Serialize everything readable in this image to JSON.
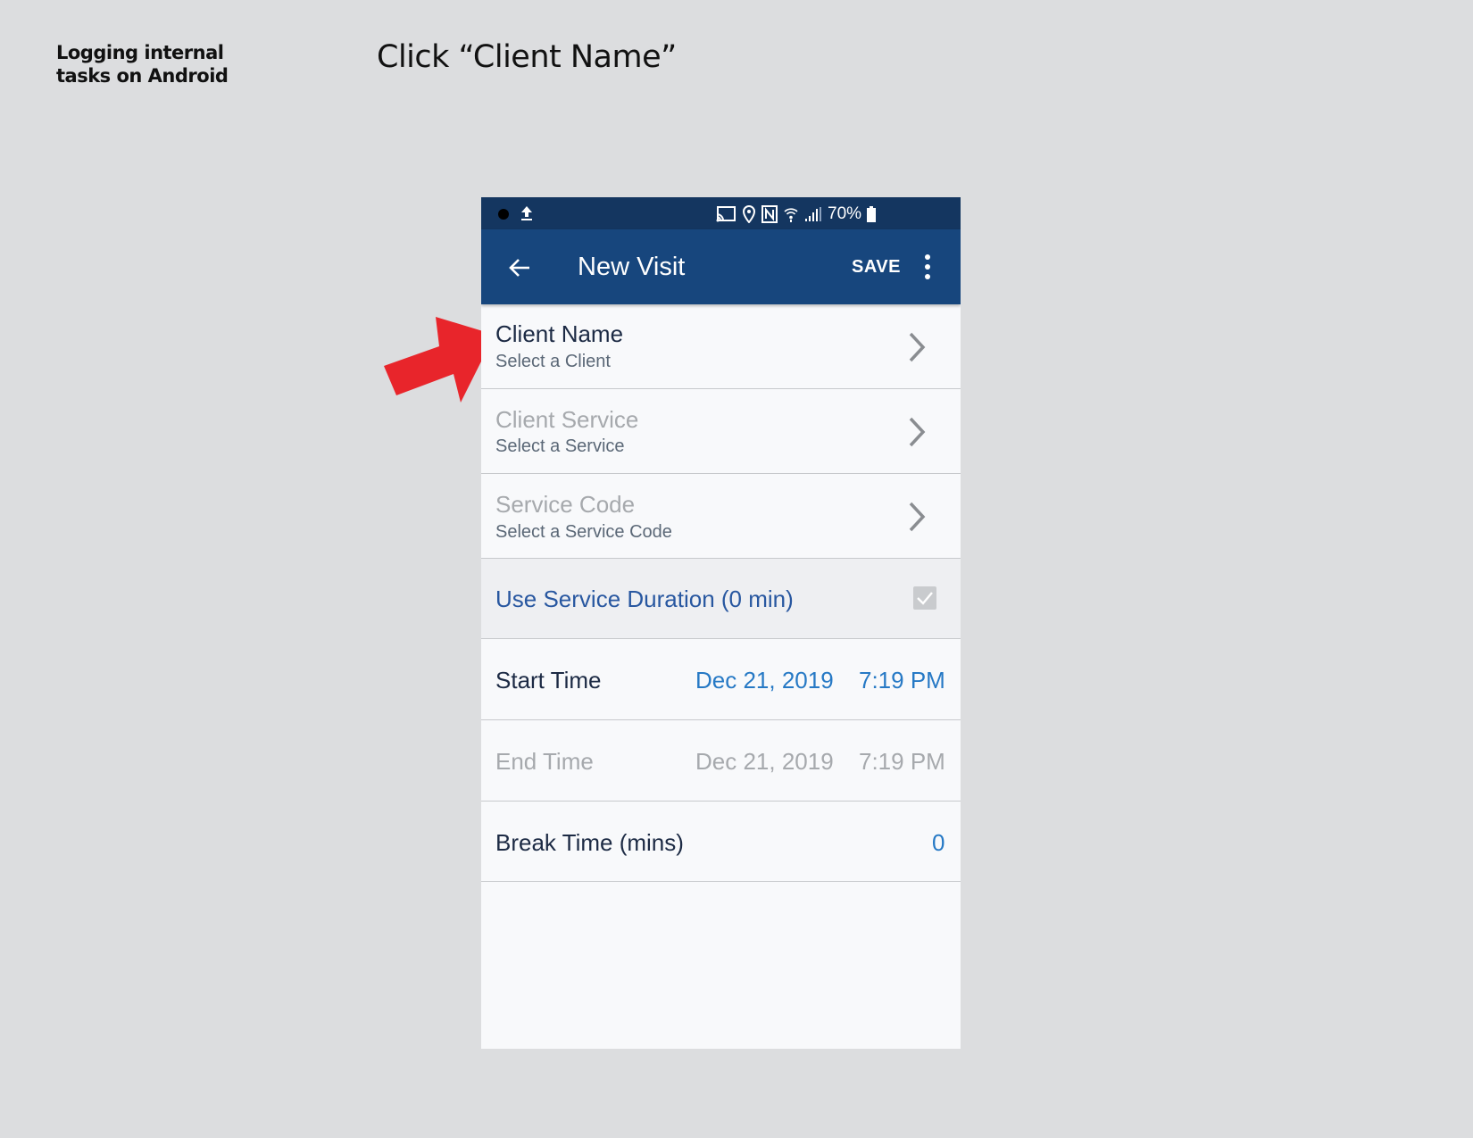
{
  "slide": {
    "title_line1": "Logging internal",
    "title_line2": "tasks on Android",
    "instruction": "Click “Client Name”"
  },
  "status_bar": {
    "battery": "70%"
  },
  "app_bar": {
    "title": "New Visit",
    "save_label": "SAVE"
  },
  "form": {
    "client_name": {
      "label": "Client Name",
      "sub": "Select a Client"
    },
    "client_service": {
      "label": "Client Service",
      "sub": "Select a Service"
    },
    "service_code": {
      "label": "Service Code",
      "sub": "Select a Service Code"
    },
    "use_duration": {
      "label": "Use Service Duration (0 min)",
      "checked": true
    },
    "start_time": {
      "label": "Start Time",
      "date": "Dec 21, 2019",
      "time": "7:19 PM"
    },
    "end_time": {
      "label": "End Time",
      "date": "Dec 21, 2019",
      "time": "7:19 PM"
    },
    "break_time": {
      "label": "Break Time (mins)",
      "value": "0"
    }
  },
  "colors": {
    "status_bar": "#143660",
    "app_bar": "#17467d",
    "accent": "#2679c5",
    "annotation_arrow": "#e8252b"
  }
}
